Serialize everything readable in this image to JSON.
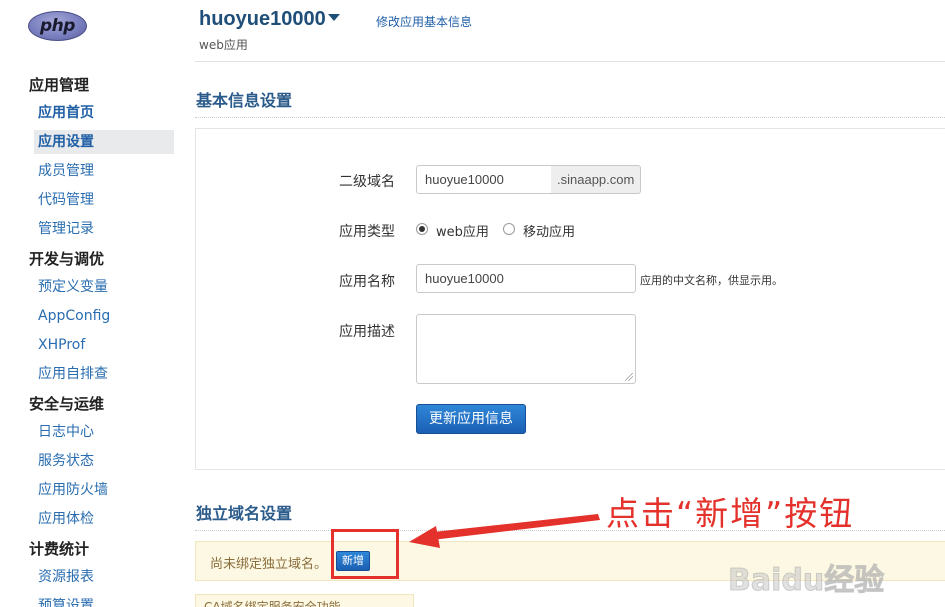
{
  "header": {
    "logo_text": "php",
    "app_name": "huoyue10000",
    "app_type": "web应用",
    "edit_link": "修改应用基本信息"
  },
  "sidebar": {
    "groups": [
      {
        "title": "应用管理",
        "items": [
          "应用首页",
          "应用设置",
          "成员管理",
          "代码管理",
          "管理记录"
        ]
      },
      {
        "title": "开发与调优",
        "items": [
          "预定义变量",
          "AppConfig",
          "XHProf",
          "应用自排查"
        ]
      },
      {
        "title": "安全与运维",
        "items": [
          "日志中心",
          "服务状态",
          "应用防火墙",
          "应用体检"
        ]
      },
      {
        "title": "计费统计",
        "items": [
          "资源报表",
          "预算设置"
        ]
      }
    ],
    "active_item": "应用设置"
  },
  "basic_info": {
    "title": "基本信息设置",
    "subdomain_label": "二级域名",
    "subdomain_value": "huoyue10000",
    "subdomain_suffix": ".sinaapp.com",
    "type_label": "应用类型",
    "type_options": [
      {
        "label": "web应用",
        "checked": true
      },
      {
        "label": "移动应用",
        "checked": false
      }
    ],
    "name_label": "应用名称",
    "name_value": "huoyue10000",
    "name_hint": "应用的中文名称，供显示用。",
    "desc_label": "应用描述",
    "desc_value": "",
    "submit_label": "更新应用信息"
  },
  "domain": {
    "title": "独立域名设置",
    "notice": "尚未绑定独立域名。",
    "add_button": "新增",
    "partial_text": "CA域名绑定服务安全功能"
  },
  "annotation": {
    "callout": "点击“新增”按钮",
    "color": "#e4312b"
  },
  "watermark": {
    "text": "Baidu经验"
  }
}
